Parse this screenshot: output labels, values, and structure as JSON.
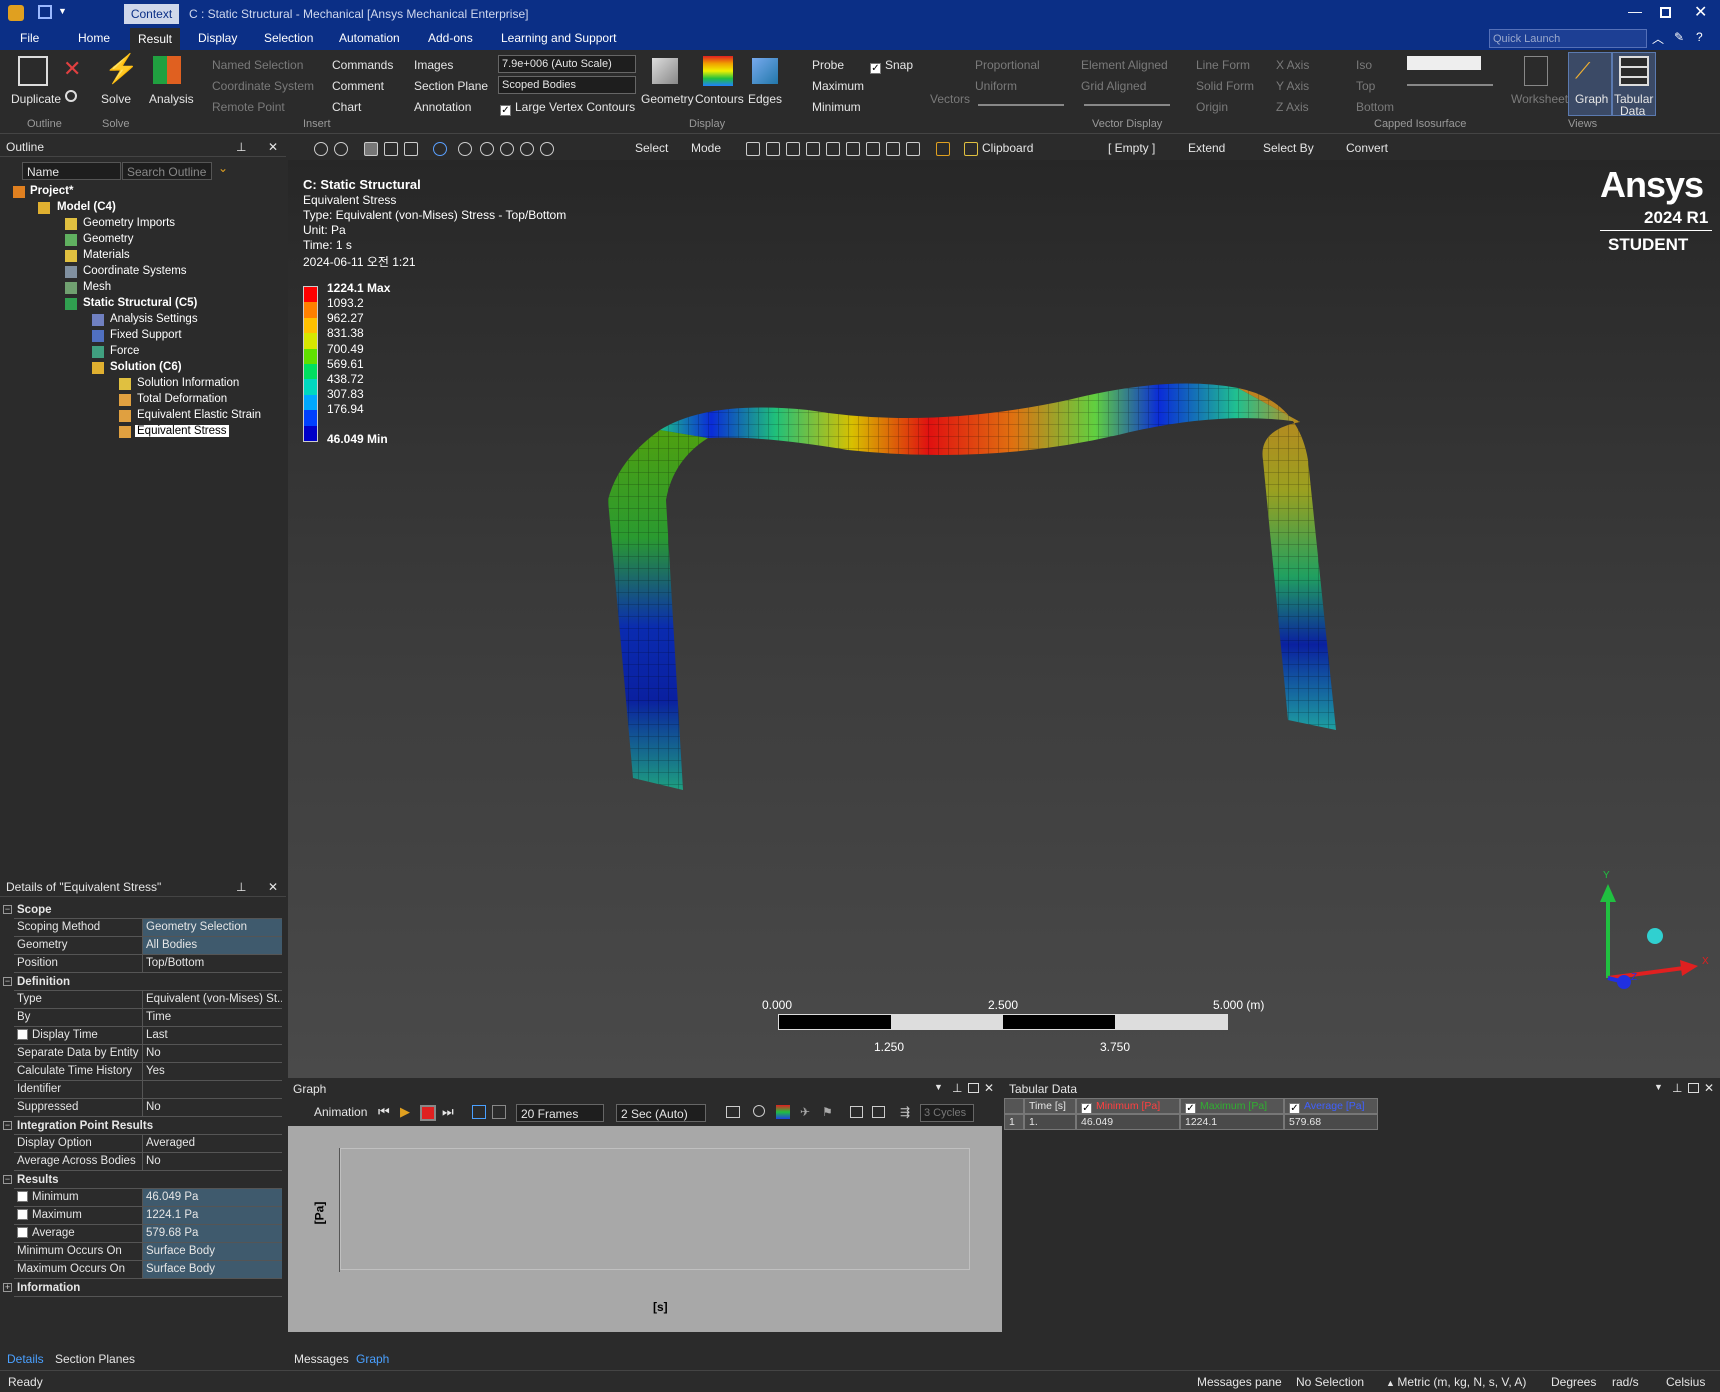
{
  "window": {
    "title": "C : Static Structural - Mechanical [Ansys Mechanical Enterprise]",
    "context_tab": "Context",
    "quick_launch_placeholder": "Quick Launch"
  },
  "menu": {
    "file": "File",
    "home": "Home",
    "result": "Result",
    "display": "Display",
    "selection": "Selection",
    "automation": "Automation",
    "addons": "Add-ons",
    "learning": "Learning and Support"
  },
  "ribbon": {
    "duplicate": "Duplicate",
    "solve": "Solve",
    "analysis": "Analysis",
    "named_selection": "Named Selection",
    "coordinate_system": "Coordinate System",
    "remote_point": "Remote Point",
    "commands": "Commands",
    "comment": "Comment",
    "chart": "Chart",
    "images": "Images",
    "section_plane": "Section Plane",
    "annotation": "Annotation",
    "scale_value": "7.9e+006 (Auto Scale)",
    "scoped_bodies": "Scoped Bodies",
    "large_vertex": "Large Vertex Contours",
    "geometry": "Geometry",
    "contours": "Contours",
    "edges": "Edges",
    "probe": "Probe",
    "maximum": "Maximum",
    "minimum": "Minimum",
    "snap": "Snap",
    "vectors": "Vectors",
    "proportional": "Proportional",
    "uniform": "Uniform",
    "element_aligned": "Element Aligned",
    "grid_aligned": "Grid Aligned",
    "line_form": "Line Form",
    "solid_form": "Solid Form",
    "origin": "Origin",
    "x_axis": "X Axis",
    "y_axis": "Y Axis",
    "z_axis": "Z Axis",
    "iso": "Iso",
    "top": "Top",
    "bottom": "Bottom",
    "worksheet": "Worksheet",
    "graph": "Graph",
    "tabular_data_1": "Tabular",
    "tabular_data_2": "Data",
    "groups": {
      "outline": "Outline",
      "solve": "Solve",
      "insert": "Insert",
      "display": "Display",
      "vector_display": "Vector Display",
      "capped_isosurface": "Capped Isosurface",
      "views": "Views"
    }
  },
  "view_toolbar": {
    "select": "Select",
    "mode": "Mode",
    "clipboard": "Clipboard",
    "empty": "[ Empty ]",
    "extend": "Extend",
    "select_by": "Select By",
    "convert": "Convert"
  },
  "outline": {
    "title": "Outline",
    "name_label": "Name",
    "search_placeholder": "Search Outline",
    "items": [
      {
        "label": "Project*",
        "bold": true
      },
      {
        "label": "Model (C4)",
        "bold": true
      },
      {
        "label": "Geometry Imports"
      },
      {
        "label": "Geometry"
      },
      {
        "label": "Materials"
      },
      {
        "label": "Coordinate Systems"
      },
      {
        "label": "Mesh"
      },
      {
        "label": "Static Structural (C5)",
        "bold": true
      },
      {
        "label": "Analysis Settings"
      },
      {
        "label": "Fixed Support"
      },
      {
        "label": "Force"
      },
      {
        "label": "Solution (C6)",
        "bold": true
      },
      {
        "label": "Solution Information"
      },
      {
        "label": "Total Deformation"
      },
      {
        "label": "Equivalent Elastic Strain"
      },
      {
        "label": "Equivalent Stress",
        "selected": true
      }
    ]
  },
  "details": {
    "title": "Details of \"Equivalent Stress\"",
    "sections": {
      "scope": "Scope",
      "definition": "Definition",
      "integration": "Integration Point Results",
      "results": "Results",
      "information": "Information"
    },
    "rows": [
      {
        "k": "Scoping Method",
        "v": "Geometry Selection"
      },
      {
        "k": "Geometry",
        "v": "All Bodies"
      },
      {
        "k": "Position",
        "v": "Top/Bottom"
      },
      {
        "k": "Type",
        "v": "Equivalent (von-Mises) St..."
      },
      {
        "k": "By",
        "v": "Time"
      },
      {
        "k": "Display Time",
        "v": "Last"
      },
      {
        "k": "Separate Data by Entity",
        "v": "No"
      },
      {
        "k": "Calculate Time History",
        "v": "Yes"
      },
      {
        "k": "Identifier",
        "v": ""
      },
      {
        "k": "Suppressed",
        "v": "No"
      },
      {
        "k": "Display Option",
        "v": "Averaged"
      },
      {
        "k": "Average Across Bodies",
        "v": "No"
      },
      {
        "k": "Minimum",
        "v": "46.049 Pa"
      },
      {
        "k": "Maximum",
        "v": "1224.1 Pa"
      },
      {
        "k": "Average",
        "v": "579.68 Pa"
      },
      {
        "k": "Minimum Occurs On",
        "v": "Surface Body"
      },
      {
        "k": "Maximum Occurs On",
        "v": "Surface Body"
      }
    ]
  },
  "left_tabs": {
    "details": "Details",
    "section_planes": "Section Planes"
  },
  "viewport": {
    "heading": "C: Static Structural",
    "result": "Equivalent Stress",
    "type": "Type: Equivalent (von-Mises) Stress - Top/Bottom",
    "unit": "Unit: Pa",
    "time": "Time: 1 s",
    "date": "2024-06-11 오전 1:21",
    "logo": "Ansys",
    "version": "2024 R1",
    "edition": "STUDENT",
    "legend": {
      "max": "1224.1 Max",
      "values": [
        "1093.2",
        "962.27",
        "831.38",
        "700.49",
        "569.61",
        "438.72",
        "307.83",
        "176.94"
      ],
      "min": "46.049 Min",
      "colors": [
        "#ff0000",
        "#ff8000",
        "#ffc000",
        "#d6e600",
        "#60e000",
        "#00e060",
        "#00d8c0",
        "#00a8ff",
        "#0040ff",
        "#0000c8"
      ]
    },
    "scale": {
      "s0": "0.000",
      "s1": "2.500",
      "s2": "5.000 (m)",
      "s3": "1.250",
      "s4": "3.750"
    },
    "triad": {
      "x": "X",
      "y": "Y",
      "z": "Z"
    }
  },
  "graph": {
    "title": "Graph",
    "animation": "Animation",
    "frames": "20 Frames",
    "duration": "2 Sec (Auto)",
    "cycles": "3 Cycles",
    "ylabel": "[Pa]",
    "xlabel": "[s]",
    "tabs": {
      "messages": "Messages",
      "graph": "Graph"
    }
  },
  "tabular": {
    "title": "Tabular Data",
    "headers": [
      "Time [s]",
      "Minimum [Pa]",
      "Maximum [Pa]",
      "Average [Pa]"
    ],
    "header_colors": [
      "#e6e6e6",
      "#ff4040",
      "#30b030",
      "#4060ff"
    ],
    "rows": [
      [
        "1",
        "1.",
        "46.049",
        "1224.1",
        "579.68"
      ]
    ]
  },
  "status": {
    "ready": "Ready",
    "messages": "Messages pane",
    "selection": "No Selection",
    "units": "Metric (m, kg, N, s, V, A)",
    "degrees": "Degrees",
    "rads": "rad/s",
    "celsius": "Celsius"
  }
}
